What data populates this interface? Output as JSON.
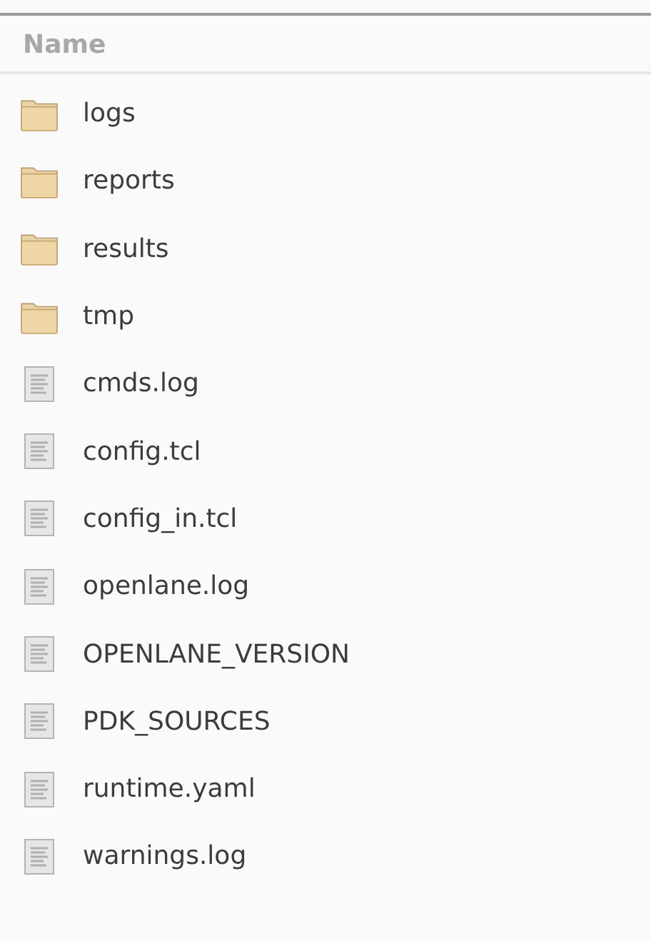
{
  "header": {
    "label": "Name"
  },
  "files": [
    {
      "name": "logs",
      "kind": "folder"
    },
    {
      "name": "reports",
      "kind": "folder"
    },
    {
      "name": "results",
      "kind": "folder"
    },
    {
      "name": "tmp",
      "kind": "folder"
    },
    {
      "name": "cmds.log",
      "kind": "file"
    },
    {
      "name": "config.tcl",
      "kind": "file"
    },
    {
      "name": "config_in.tcl",
      "kind": "file"
    },
    {
      "name": "openlane.log",
      "kind": "file"
    },
    {
      "name": "OPENLANE_VERSION",
      "kind": "file"
    },
    {
      "name": "PDK_SOURCES",
      "kind": "file"
    },
    {
      "name": "runtime.yaml",
      "kind": "file"
    },
    {
      "name": "warnings.log",
      "kind": "file"
    }
  ]
}
